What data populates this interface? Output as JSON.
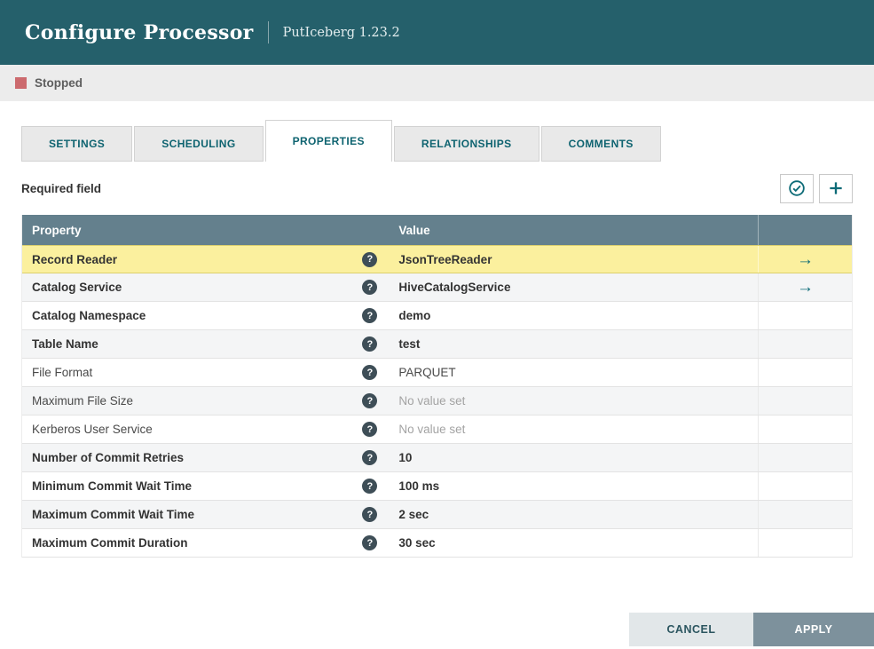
{
  "header": {
    "title": "Configure Processor",
    "subtitle": "PutIceberg 1.23.2"
  },
  "status": {
    "label": "Stopped",
    "color": "#cc6a6e"
  },
  "tabs": [
    {
      "label": "SETTINGS",
      "active": false
    },
    {
      "label": "SCHEDULING",
      "active": false
    },
    {
      "label": "PROPERTIES",
      "active": true
    },
    {
      "label": "RELATIONSHIPS",
      "active": false
    },
    {
      "label": "COMMENTS",
      "active": false
    }
  ],
  "toolbar": {
    "required_label": "Required field",
    "verify_button_icon": "verify-properties-check-circle-icon",
    "add_button_icon": "add-property-plus-icon"
  },
  "table": {
    "columns": [
      "Property",
      "Value"
    ],
    "rows": [
      {
        "property": "Record Reader",
        "value": "JsonTreeReader",
        "required": true,
        "highlighted": true,
        "empty": false,
        "go_to": true
      },
      {
        "property": "Catalog Service",
        "value": "HiveCatalogService",
        "required": true,
        "highlighted": false,
        "empty": false,
        "go_to": true
      },
      {
        "property": "Catalog Namespace",
        "value": "demo",
        "required": true,
        "highlighted": false,
        "empty": false,
        "go_to": false
      },
      {
        "property": "Table Name",
        "value": "test",
        "required": true,
        "highlighted": false,
        "empty": false,
        "go_to": false
      },
      {
        "property": "File Format",
        "value": "PARQUET",
        "required": false,
        "highlighted": false,
        "empty": false,
        "go_to": false
      },
      {
        "property": "Maximum File Size",
        "value": "No value set",
        "required": false,
        "highlighted": false,
        "empty": true,
        "go_to": false
      },
      {
        "property": "Kerberos User Service",
        "value": "No value set",
        "required": false,
        "highlighted": false,
        "empty": true,
        "go_to": false
      },
      {
        "property": "Number of Commit Retries",
        "value": "10",
        "required": true,
        "highlighted": false,
        "empty": false,
        "go_to": false
      },
      {
        "property": "Minimum Commit Wait Time",
        "value": "100 ms",
        "required": true,
        "highlighted": false,
        "empty": false,
        "go_to": false
      },
      {
        "property": "Maximum Commit Wait Time",
        "value": "2 sec",
        "required": true,
        "highlighted": false,
        "empty": false,
        "go_to": false
      },
      {
        "property": "Maximum Commit Duration",
        "value": "30 sec",
        "required": true,
        "highlighted": false,
        "empty": false,
        "go_to": false
      }
    ]
  },
  "footer": {
    "cancel_label": "CANCEL",
    "apply_label": "APPLY"
  },
  "colors": {
    "header_bg": "#25606b",
    "accent_teal": "#0d6b77",
    "table_header_bg": "#64808d",
    "highlight_row": "#fbf09e",
    "stopped_red": "#cc6a6e"
  }
}
